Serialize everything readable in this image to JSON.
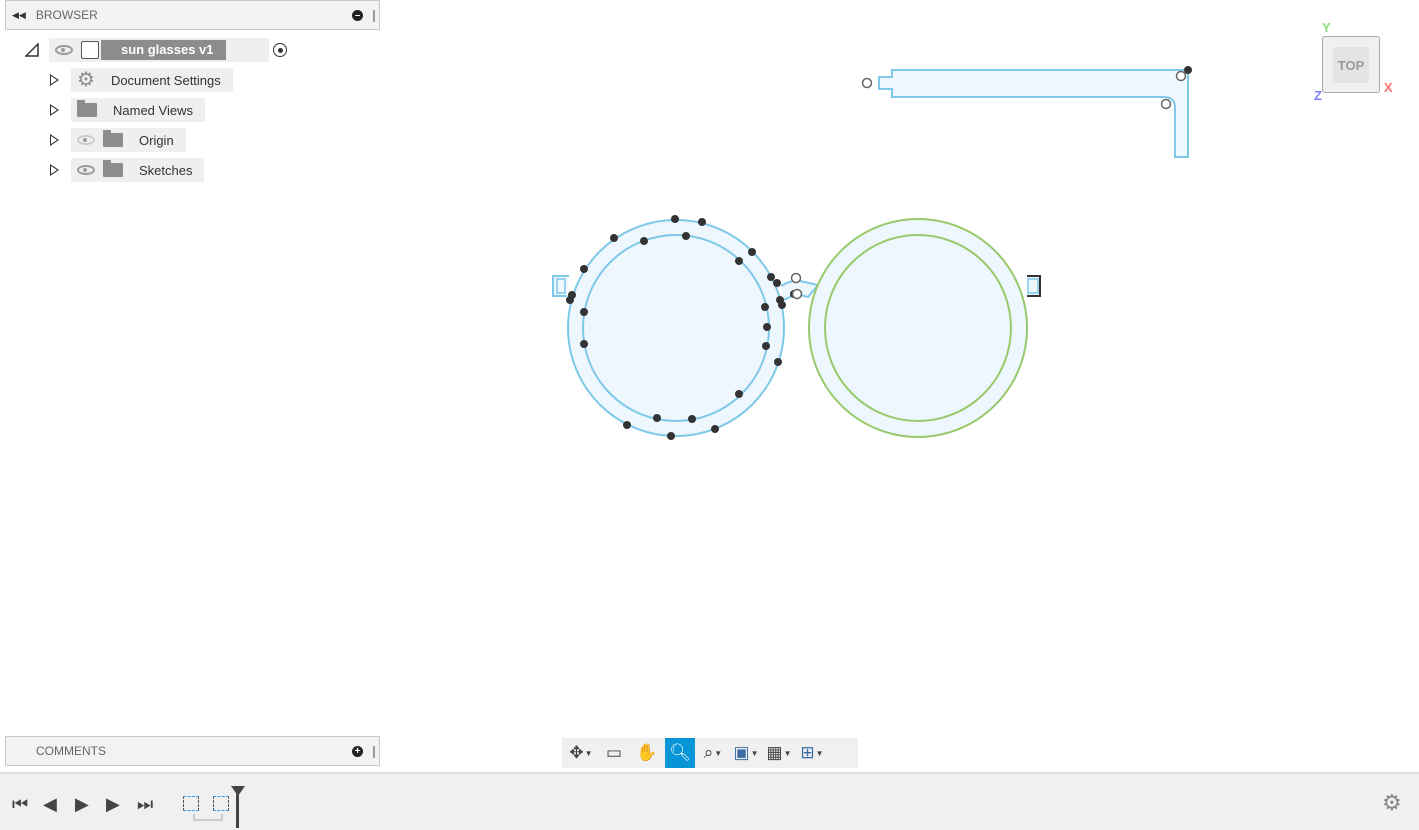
{
  "browser": {
    "title": "BROWSER",
    "root": {
      "label": "sun glasses v1"
    },
    "items": [
      {
        "label": "Document Settings",
        "icon": "gear-icon"
      },
      {
        "label": "Named Views",
        "icon": "folder-icon"
      },
      {
        "label": "Origin",
        "icon": "folder-icon",
        "visible": false
      },
      {
        "label": "Sketches",
        "icon": "folder-icon",
        "visible": true
      }
    ]
  },
  "comments": {
    "title": "COMMENTS"
  },
  "viewcube": {
    "face": "TOP",
    "x": "X",
    "y": "Y",
    "z": "Z"
  },
  "colors": {
    "accent": "#0696d7",
    "sketch_blue": "#7ec8ea",
    "sketch_green": "#98c96b",
    "fill": "#eef7fd"
  },
  "navbar": {
    "tools": [
      "orbit-icon",
      "look-at-icon",
      "pan-icon",
      "zoom-icon",
      "fit-icon",
      "display-settings-icon",
      "grid-icon",
      "viewports-icon"
    ],
    "active": "zoom-icon"
  },
  "timeline": {
    "controls": [
      "first",
      "previous",
      "play",
      "next",
      "last"
    ]
  }
}
